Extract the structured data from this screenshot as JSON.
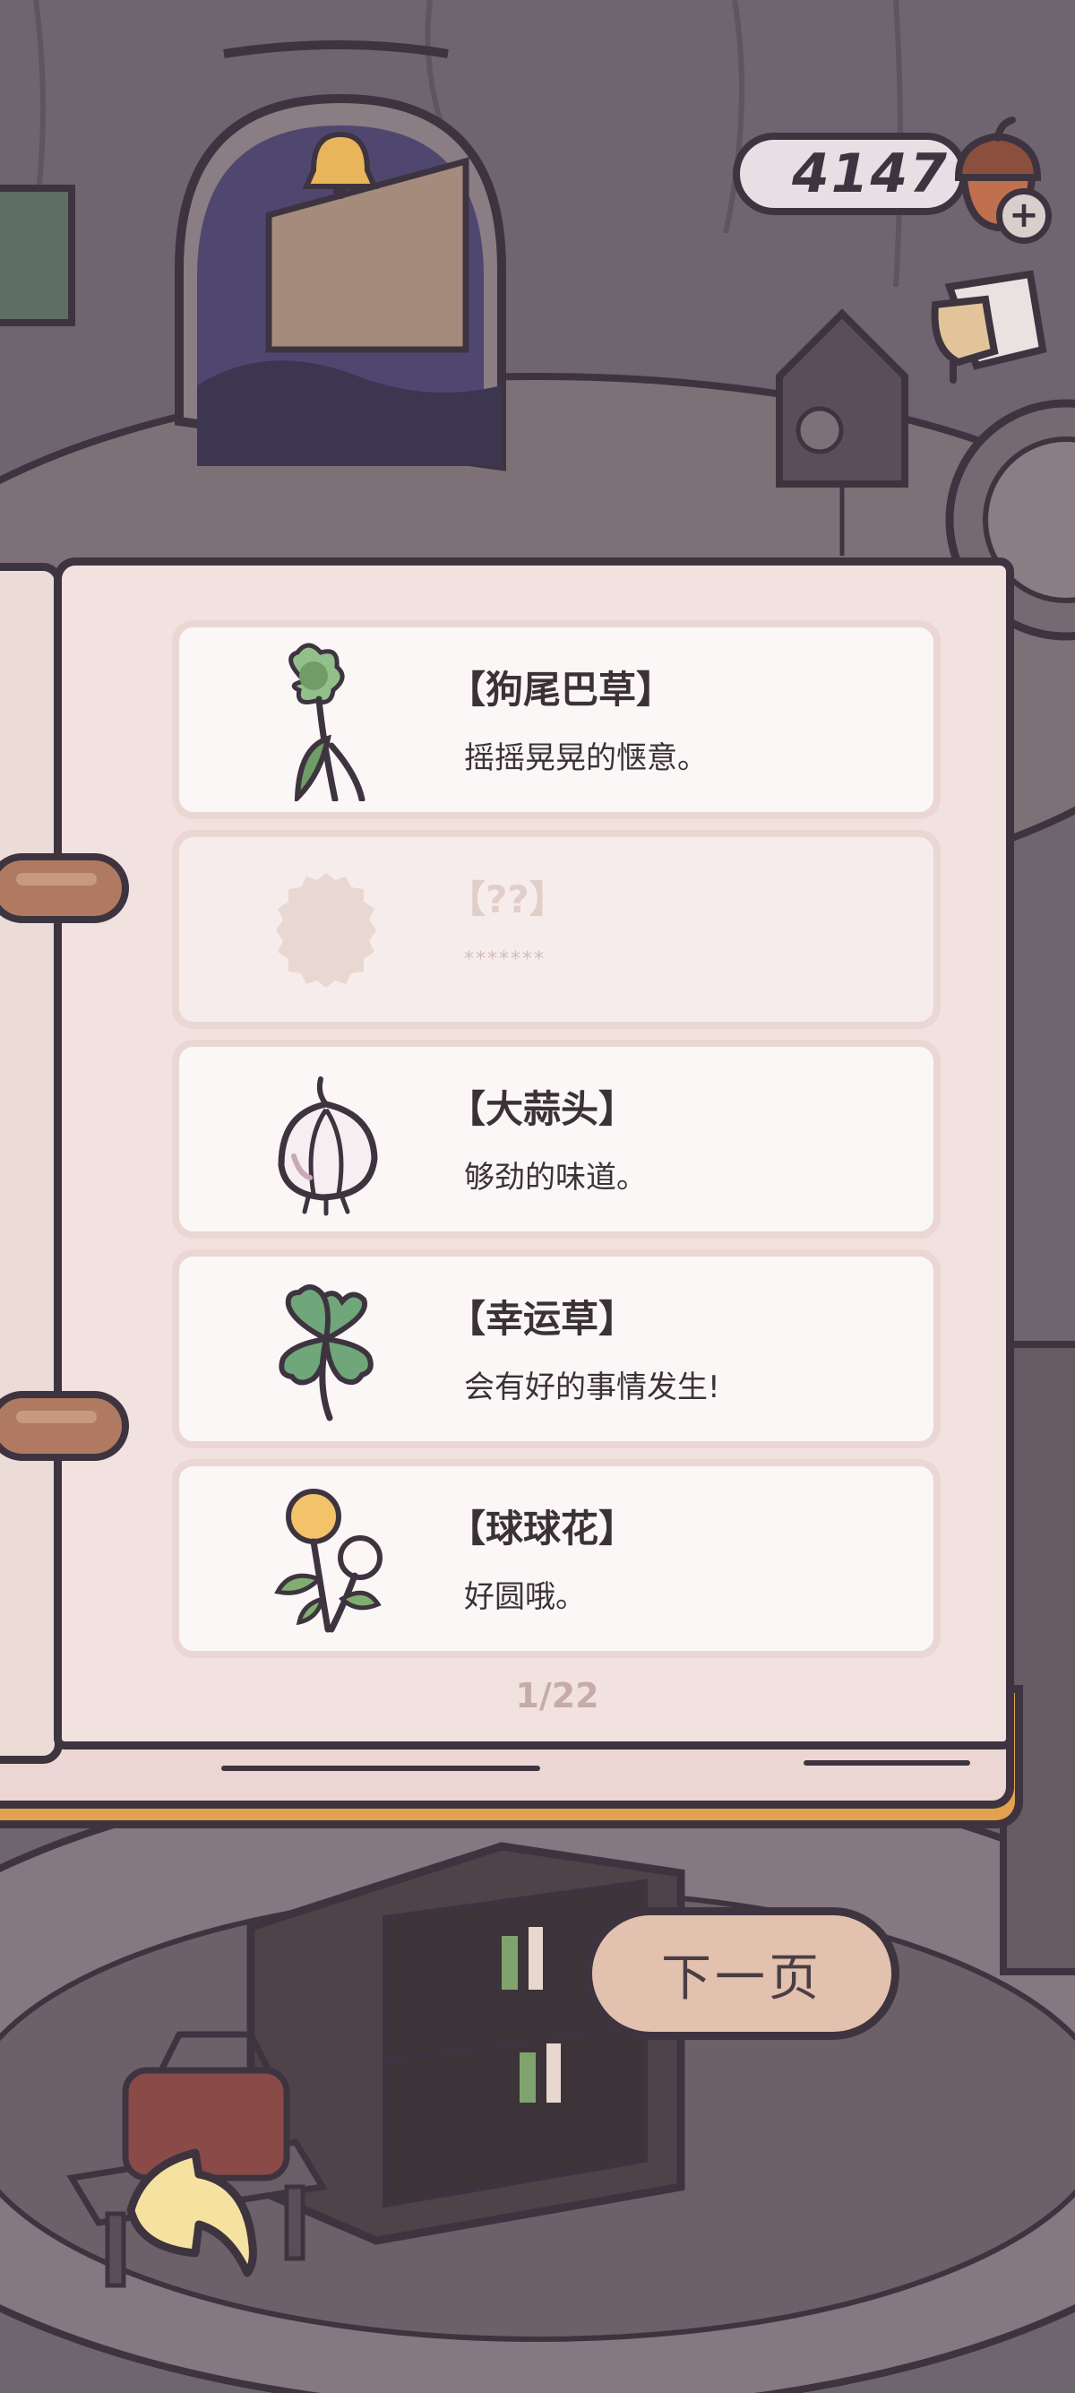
{
  "currency": {
    "amount": "4147",
    "icon": "acorn-coin-icon",
    "add_icon": "plus-icon"
  },
  "book": {
    "entries": [
      {
        "title": "【狗尾巴草】",
        "description": "摇摇晃晃的惬意。",
        "icon": "foxtail-grass-icon",
        "discovered": true
      },
      {
        "title": "【??】",
        "description": "*******",
        "icon": "unknown-silhouette-icon",
        "discovered": false
      },
      {
        "title": "【大蒜头】",
        "description": "够劲的味道。",
        "icon": "garlic-icon",
        "discovered": true
      },
      {
        "title": "【幸运草】",
        "description": "会有好的事情发生!",
        "icon": "four-leaf-clover-icon",
        "discovered": true
      },
      {
        "title": "【球球花】",
        "description": "好圆哦。",
        "icon": "ball-flower-icon",
        "discovered": true
      }
    ],
    "page_indicator": "1/22"
  },
  "controls": {
    "next_page_label": "下一页",
    "back_icon": "back-arrow-icon"
  },
  "colors": {
    "background": "#6f6570",
    "outline": "#3e3440",
    "page": "#f1e1df",
    "card": "#fbf7f6",
    "button": "#e2c1ae",
    "book_cover": "#e3a24f"
  }
}
